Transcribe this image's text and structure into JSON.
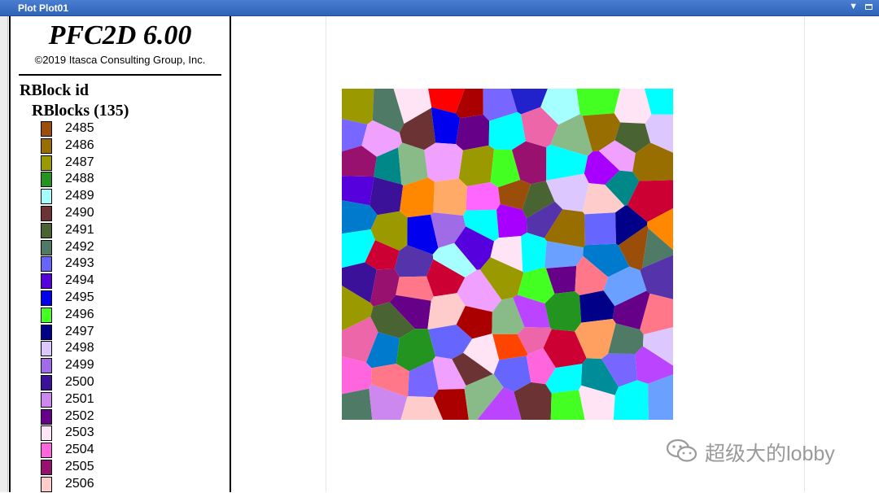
{
  "window": {
    "title": "Plot Plot01"
  },
  "legend": {
    "app_name": "PFC2D 6.00",
    "copyright": "©2019 Itasca Consulting Group, Inc.",
    "item_title": "RBlock id",
    "item_subtitle": "RBlocks (135)",
    "entries": [
      {
        "label": "2485",
        "color": "#9b4d0a"
      },
      {
        "label": "2486",
        "color": "#996e00"
      },
      {
        "label": "2487",
        "color": "#9a9a00"
      },
      {
        "label": "2488",
        "color": "#22941f"
      },
      {
        "label": "2489",
        "color": "#a6ffff"
      },
      {
        "label": "2490",
        "color": "#6b3333"
      },
      {
        "label": "2491",
        "color": "#4a6333"
      },
      {
        "label": "2492",
        "color": "#4f7a66"
      },
      {
        "label": "2493",
        "color": "#6666ff"
      },
      {
        "label": "2494",
        "color": "#5500dd"
      },
      {
        "label": "2495",
        "color": "#0000ee"
      },
      {
        "label": "2496",
        "color": "#44ff22"
      },
      {
        "label": "2497",
        "color": "#000088"
      },
      {
        "label": "2498",
        "color": "#dcc8ff"
      },
      {
        "label": "2499",
        "color": "#9f6be6"
      },
      {
        "label": "2500",
        "color": "#3b1199"
      },
      {
        "label": "2501",
        "color": "#cc88ee"
      },
      {
        "label": "2502",
        "color": "#660088"
      },
      {
        "label": "2503",
        "color": "#ffe4f5"
      },
      {
        "label": "2504",
        "color": "#ff66dd"
      },
      {
        "label": "2505",
        "color": "#99116e"
      },
      {
        "label": "2506",
        "color": "#ffcccc"
      }
    ]
  },
  "plot": {
    "palette": [
      "#9b4d0a",
      "#996e00",
      "#9a9a00",
      "#22941f",
      "#a6ffff",
      "#6b3333",
      "#4a6333",
      "#4f7a66",
      "#6666ff",
      "#5500dd",
      "#0000ee",
      "#44ff22",
      "#000088",
      "#dcc8ff",
      "#9f6be6",
      "#3b1199",
      "#cc88ee",
      "#660088",
      "#ffe4f5",
      "#ff66dd",
      "#99116e",
      "#ffcccc",
      "#ff8800",
      "#ff4400",
      "#ff0000",
      "#00ffff",
      "#ff7788",
      "#008888",
      "#ffaa66",
      "#aa0000",
      "#a800ff",
      "#6aa0ff",
      "#ee66aa",
      "#008d9a",
      "#ff66ff",
      "#cc0033",
      "#7766ff",
      "#88bb88",
      "#007acc",
      "#5533aa",
      "#f0a0ff",
      "#330066",
      "#2222cc",
      "#ffa060",
      "#bb44ff"
    ]
  },
  "watermark": {
    "icon": "wechat-icon",
    "text": "超级大的lobby"
  }
}
